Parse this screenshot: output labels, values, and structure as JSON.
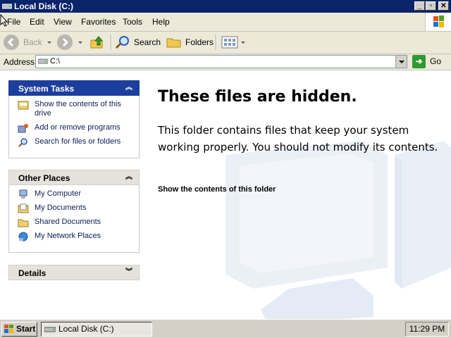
{
  "window": {
    "title": "Local Disk (C:)"
  },
  "menu": [
    "File",
    "Edit",
    "View",
    "Favorites",
    "Tools",
    "Help"
  ],
  "toolbar": {
    "back": "Back",
    "search": "Search",
    "folders": "Folders"
  },
  "address": {
    "label": "Address",
    "value": "C:\\",
    "go": "Go"
  },
  "system_tasks": {
    "title": "System Tasks",
    "items": [
      "Show the contents of this drive",
      "Add or remove programs",
      "Search for files or folders"
    ]
  },
  "other_places": {
    "title": "Other Places",
    "items": [
      "My Computer",
      "My Documents",
      "Shared Documents",
      "My Network Places"
    ]
  },
  "details": {
    "title": "Details"
  },
  "main": {
    "heading": "These files are hidden.",
    "description": "This folder contains files that keep your system working properly. You should not modify its contents.",
    "link": "Show the contents of this folder"
  },
  "taskbar": {
    "start": "Start",
    "window_item": "Local Disk (C:)",
    "clock": "11:29 PM"
  },
  "colors": {
    "titlebar": "#0a246a",
    "task_header": "#1c3e9c",
    "link_text": "#0c1e55"
  }
}
